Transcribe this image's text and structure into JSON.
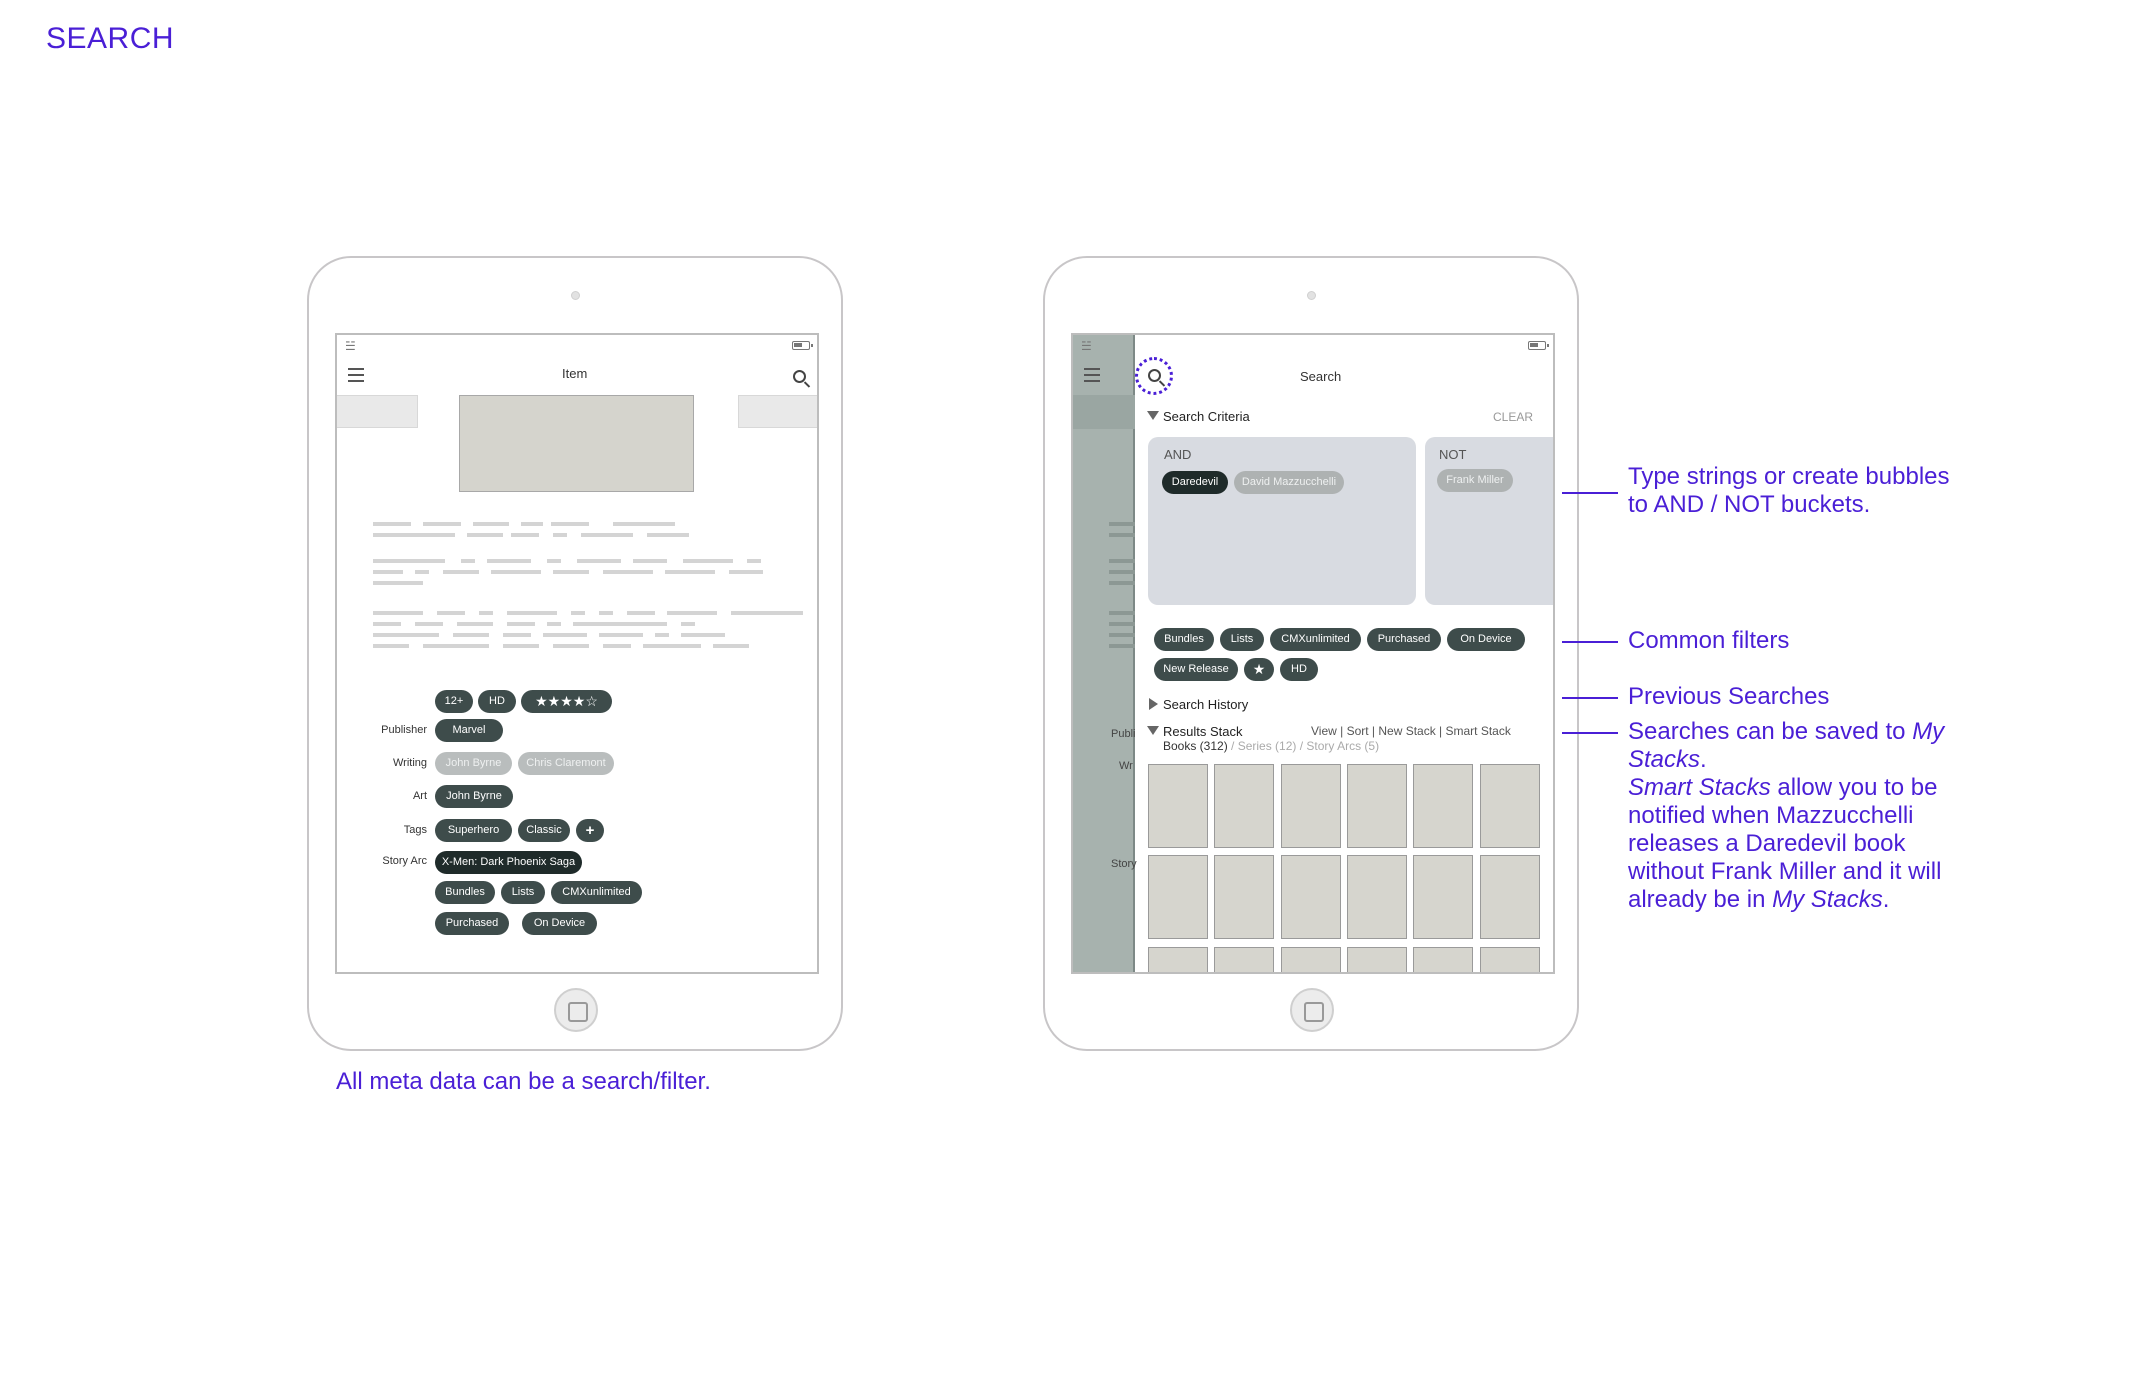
{
  "page_title": "SEARCH",
  "left_tablet": {
    "nav_title": "Item",
    "chips_top": [
      "12+",
      "HD",
      "★★★★☆"
    ],
    "meta": [
      {
        "label": "Publisher",
        "chips": [
          "Marvel"
        ]
      },
      {
        "label": "Writing",
        "chips": [
          "John Byrne",
          "Chris Claremont"
        ]
      },
      {
        "label": "Art",
        "chips": [
          "John Byrne"
        ]
      },
      {
        "label": "Tags",
        "chips": [
          "Superhero",
          "Classic",
          "+"
        ]
      },
      {
        "label": "Story Arc",
        "chips": [
          "X-Men: Dark Phoenix Saga"
        ]
      }
    ],
    "chips_bottom": [
      "Bundles",
      "Lists",
      "CMXunlimited",
      "Purchased",
      "On Device"
    ],
    "caption": "All meta data can be a search/filter."
  },
  "right_tablet": {
    "nav_title": "Search",
    "search_criteria_label": "Search Criteria",
    "clear_label": "CLEAR",
    "and_bucket": {
      "title": "AND",
      "chips": [
        "Daredevil",
        "David Mazzucchelli"
      ]
    },
    "not_bucket": {
      "title": "NOT",
      "chips": [
        "Frank Miller"
      ]
    },
    "filters": [
      "Bundles",
      "Lists",
      "CMXunlimited",
      "Purchased",
      "On Device",
      "New Release",
      "★",
      "HD"
    ],
    "search_history_label": "Search History",
    "results_stack_label": "Results Stack",
    "results_actions": "View | Sort | New Stack | Smart Stack",
    "results_counts": {
      "books": "Books (312)",
      "rest": " / Series (12) / Story Arcs (5)"
    },
    "sidebar_labels": {
      "publisher": "Publi",
      "writing": "Wr",
      "story": "Story"
    }
  },
  "annotations": {
    "buckets": [
      "Type strings or create bubbles",
      "to AND / NOT buckets."
    ],
    "filters": "Common filters",
    "history": "Previous Searches",
    "stacks_1a": "Searches can be saved to ",
    "stacks_1b": "My",
    "stacks_2": "Stacks",
    "stacks_3a": "Smart Stacks",
    "stacks_3b": " allow you to be",
    "stacks_4": "notified when Mazzucchelli",
    "stacks_5": "releases a Daredevil book",
    "stacks_6": "without Frank Miller and it will",
    "stacks_7a": "already be in ",
    "stacks_7b": "My Stacks"
  },
  "colors": {
    "accent": "#4a1fd6",
    "chip_dark": "#3e4c4b",
    "chip_light": "#b9bdbd",
    "bucket": "#d8dbe1"
  }
}
